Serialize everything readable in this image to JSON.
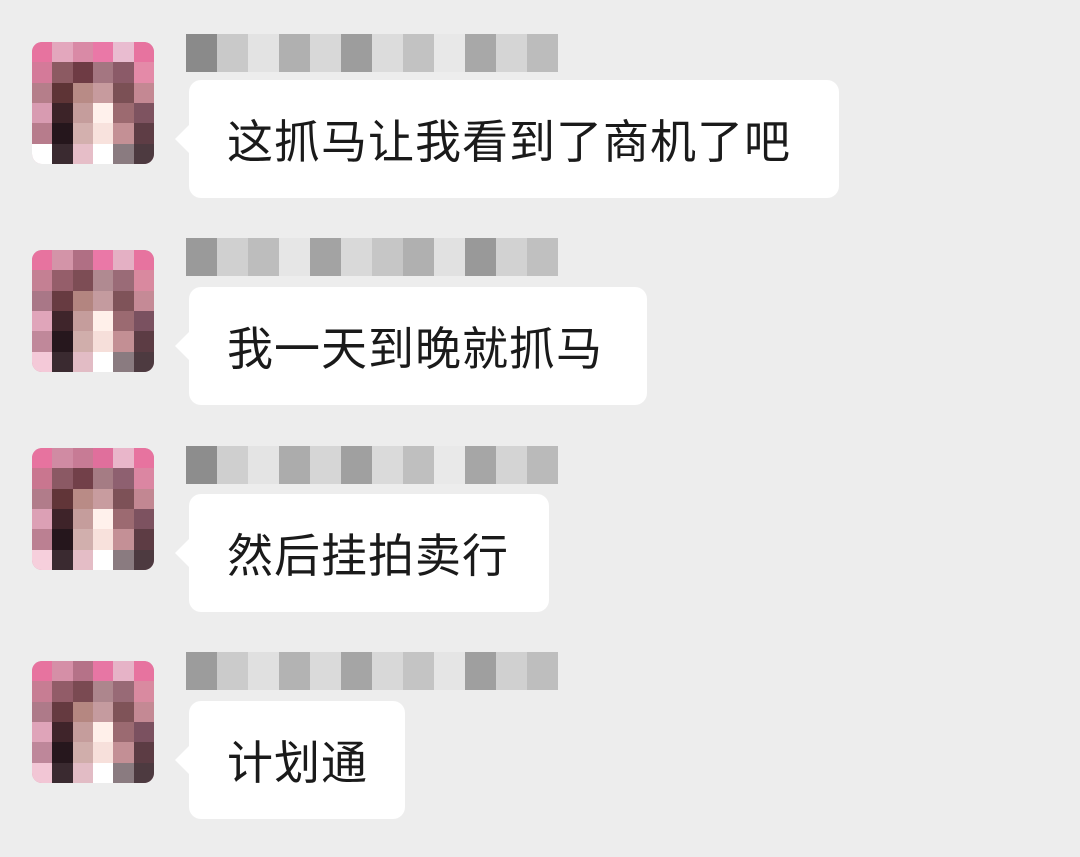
{
  "chat": {
    "messages": [
      {
        "sender_name": "",
        "text": "这抓马让我看到了商机了吧",
        "avatar_icon": "pixelated-avatar-icon"
      },
      {
        "sender_name": "",
        "text": "我一天到晚就抓马",
        "avatar_icon": "pixelated-avatar-icon"
      },
      {
        "sender_name": "",
        "text": "然后挂拍卖行",
        "avatar_icon": "pixelated-avatar-icon"
      },
      {
        "sender_name": "",
        "text": "计划通",
        "avatar_icon": "pixelated-avatar-icon"
      }
    ]
  },
  "colors": {
    "background": "#ededed",
    "bubble": "#ffffff",
    "text": "#1a1a1a"
  }
}
